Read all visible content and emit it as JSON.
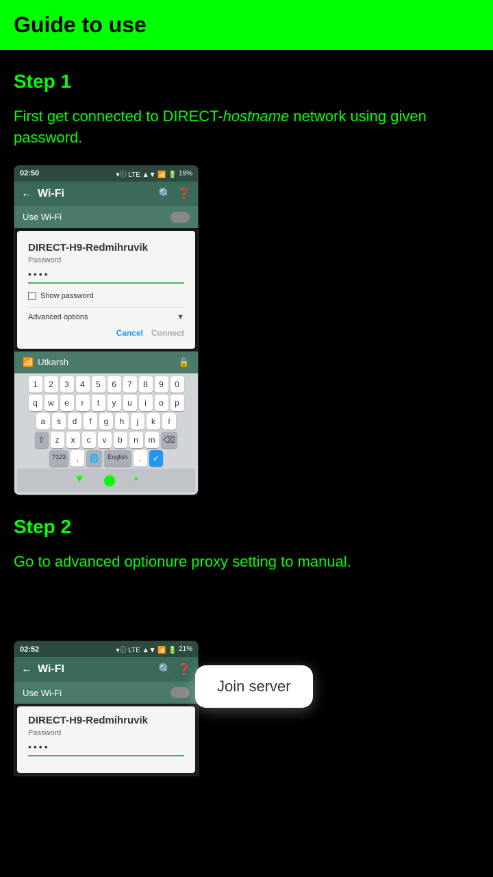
{
  "header": {
    "title": "Guide to use",
    "bg_color": "#00ff00"
  },
  "step1": {
    "label": "Step 1",
    "description_part1": "First get connected to DIRECT-",
    "description_italic": "hostname",
    "description_part2": " network using given password."
  },
  "phone1": {
    "status_time": "02:50",
    "status_battery": "19%",
    "wifi_title": "Wi-Fi",
    "use_wifi_label": "Use Wi-Fi",
    "dialog_title": "DIRECT-H9-Redmihruvik",
    "dialog_subtitle": "Password",
    "password_dots": "••••",
    "show_password": "Show password",
    "advanced_options": "Advanced options",
    "cancel_btn": "Cancel",
    "connect_btn": "Connect",
    "network_name": "Utkarsh"
  },
  "keyboard": {
    "row1": [
      "1",
      "2",
      "3",
      "4",
      "5",
      "6",
      "7",
      "8",
      "9",
      "0"
    ],
    "row2": [
      "q",
      "w",
      "e",
      "r",
      "t",
      "y",
      "u",
      "i",
      "o",
      "p"
    ],
    "row3": [
      "a",
      "s",
      "d",
      "f",
      "g",
      "h",
      "j",
      "k",
      "l"
    ],
    "row4": [
      "z",
      "x",
      "c",
      "v",
      "b",
      "n",
      "m"
    ],
    "bottom": [
      "?123",
      ",",
      "🌐",
      "English",
      ".",
      "✓"
    ]
  },
  "step2": {
    "label": "Step 2",
    "description_part1": "Go to advanced option",
    "description_part2": "ure proxy setting to manual."
  },
  "phone2": {
    "status_time": "02:52",
    "status_battery": "21%",
    "wifi_title": "Wi-FI",
    "use_wifi_label": "Use Wi-Fi",
    "dialog_title": "DIRECT-H9-Redmihruvik",
    "dialog_subtitle": "Password",
    "password_dots": "••••"
  },
  "join_server_tooltip": {
    "label": "Join server"
  }
}
